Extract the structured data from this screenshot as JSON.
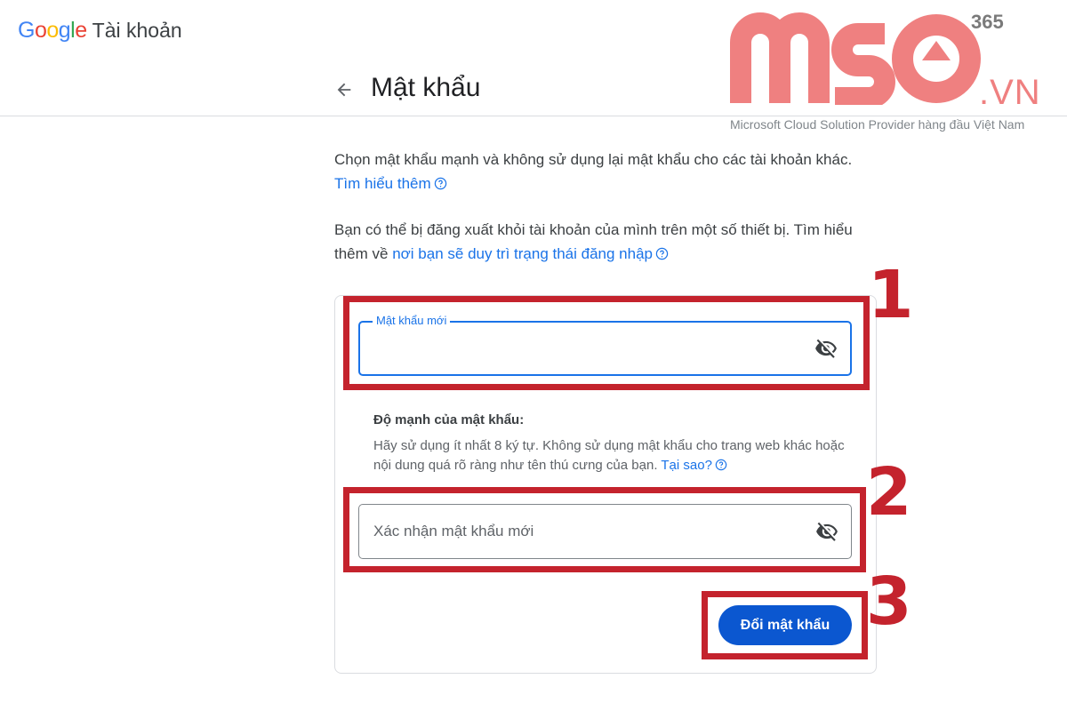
{
  "brand": {
    "google_letters": [
      {
        "ch": "G",
        "color": "#4285F4"
      },
      {
        "ch": "o",
        "color": "#EA4335"
      },
      {
        "ch": "o",
        "color": "#FBBC05"
      },
      {
        "ch": "g",
        "color": "#4285F4"
      },
      {
        "ch": "l",
        "color": "#34A853"
      },
      {
        "ch": "e",
        "color": "#EA4335"
      }
    ],
    "product": "Tài khoản"
  },
  "header": {
    "back_icon": "arrow-back-icon",
    "title": "Mật khẩu"
  },
  "watermark": {
    "logo_letters": "MSO",
    "suffix": "365",
    "domain": ".VN",
    "tagline": "Microsoft Cloud Solution Provider hàng đầu Việt Nam",
    "color": "#ef8080"
  },
  "intro": {
    "text": "Chọn mật khẩu mạnh và không sử dụng lại mật khẩu cho các tài khoản khác. ",
    "link": "Tìm hiểu thêm"
  },
  "signout_note": {
    "text": "Bạn có thể bị đăng xuất khỏi tài khoản của mình trên một số thiết bị. Tìm hiểu thêm về ",
    "link": "nơi bạn sẽ duy trì trạng thái đăng nhập"
  },
  "form": {
    "new_password": {
      "label": "Mật khẩu mới",
      "value": "",
      "icon": "eye-off-icon"
    },
    "strength": {
      "title": "Độ mạnh của mật khẩu:",
      "text": "Hãy sử dụng ít nhất 8 ký tự. Không sử dụng mật khẩu cho trang web khác hoặc nội dung quá rõ ràng như tên thú cưng của bạn. ",
      "link": "Tại sao?"
    },
    "confirm_password": {
      "placeholder": "Xác nhận mật khẩu mới",
      "value": "",
      "icon": "eye-off-icon"
    },
    "submit_label": "Đổi mật khẩu"
  },
  "annotations": {
    "steps": [
      "1",
      "2",
      "3"
    ],
    "color": "#c4232d"
  },
  "colors": {
    "accent": "#1a73e8",
    "button": "#0b57d0"
  }
}
